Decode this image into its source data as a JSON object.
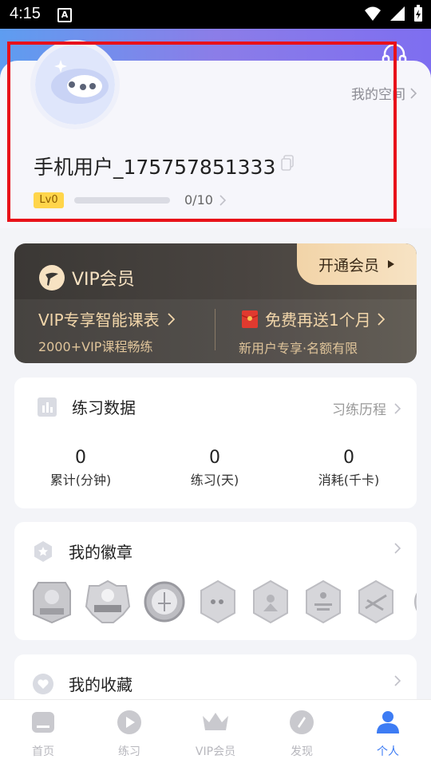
{
  "status_bar": {
    "time": "4:15",
    "notification_letter": "A"
  },
  "profile": {
    "my_space": "我的空间",
    "username": "手机用户_175757851333",
    "level_badge": "Lv0",
    "level_progress_text": "0/10",
    "level_progress_fraction": 0
  },
  "vip": {
    "title": "VIP会员",
    "open_button": "开通会员",
    "left_main": "VIP专享智能课表",
    "left_sub": "2000+VIP课程畅练",
    "right_main": "免费再送1个月",
    "right_sub": "新用户专享·名额有限"
  },
  "practice": {
    "title": "练习数据",
    "link": "习练历程",
    "stats": [
      {
        "value": "0",
        "label": "累计(分钟)"
      },
      {
        "value": "0",
        "label": "练习(天)"
      },
      {
        "value": "0",
        "label": "消耗(千卡)"
      }
    ]
  },
  "badges": {
    "title": "我的徽章"
  },
  "favorites": {
    "title": "我的收藏"
  },
  "bottom_nav": [
    {
      "label": "首页",
      "icon": "home-icon"
    },
    {
      "label": "练习",
      "icon": "play-icon"
    },
    {
      "label": "VIP会员",
      "icon": "crown-icon"
    },
    {
      "label": "发现",
      "icon": "compass-icon"
    },
    {
      "label": "个人",
      "icon": "person-icon",
      "active": true
    }
  ],
  "colors": {
    "accent": "#3d7cf4",
    "highlight_box": "#e8111a",
    "vip_gold": "#f2d6aa"
  }
}
